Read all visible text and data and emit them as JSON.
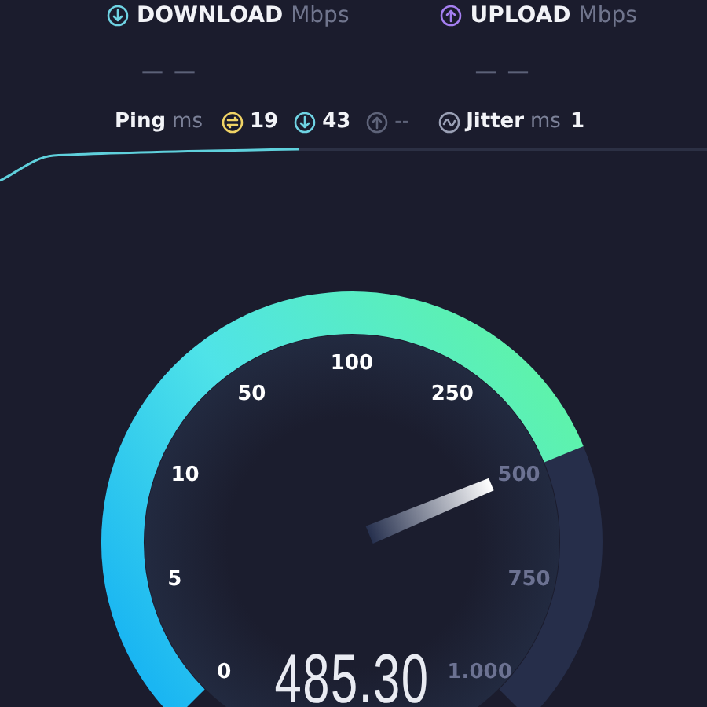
{
  "results": [
    {
      "kind": "download",
      "label": "DOWNLOAD",
      "unit": "Mbps",
      "value": "— —"
    },
    {
      "kind": "upload",
      "label": "UPLOAD",
      "unit": "Mbps",
      "value": "— —"
    }
  ],
  "latency": {
    "label": "Ping",
    "unit": "ms",
    "items": [
      {
        "kind": "idle",
        "value": "19"
      },
      {
        "kind": "download",
        "value": "43"
      },
      {
        "kind": "upload",
        "value": "--"
      }
    ]
  },
  "jitter": {
    "label": "Jitter",
    "unit": "ms",
    "value": "1"
  },
  "gauge": {
    "reading": "485.30",
    "ticks": [
      {
        "label": "0",
        "reached": true
      },
      {
        "label": "5",
        "reached": true
      },
      {
        "label": "10",
        "reached": true
      },
      {
        "label": "50",
        "reached": true
      },
      {
        "label": "100",
        "reached": true
      },
      {
        "label": "250",
        "reached": true
      },
      {
        "label": "500",
        "reached": false
      },
      {
        "label": "750",
        "reached": false
      },
      {
        "label": "1.000",
        "reached": false
      }
    ]
  }
}
